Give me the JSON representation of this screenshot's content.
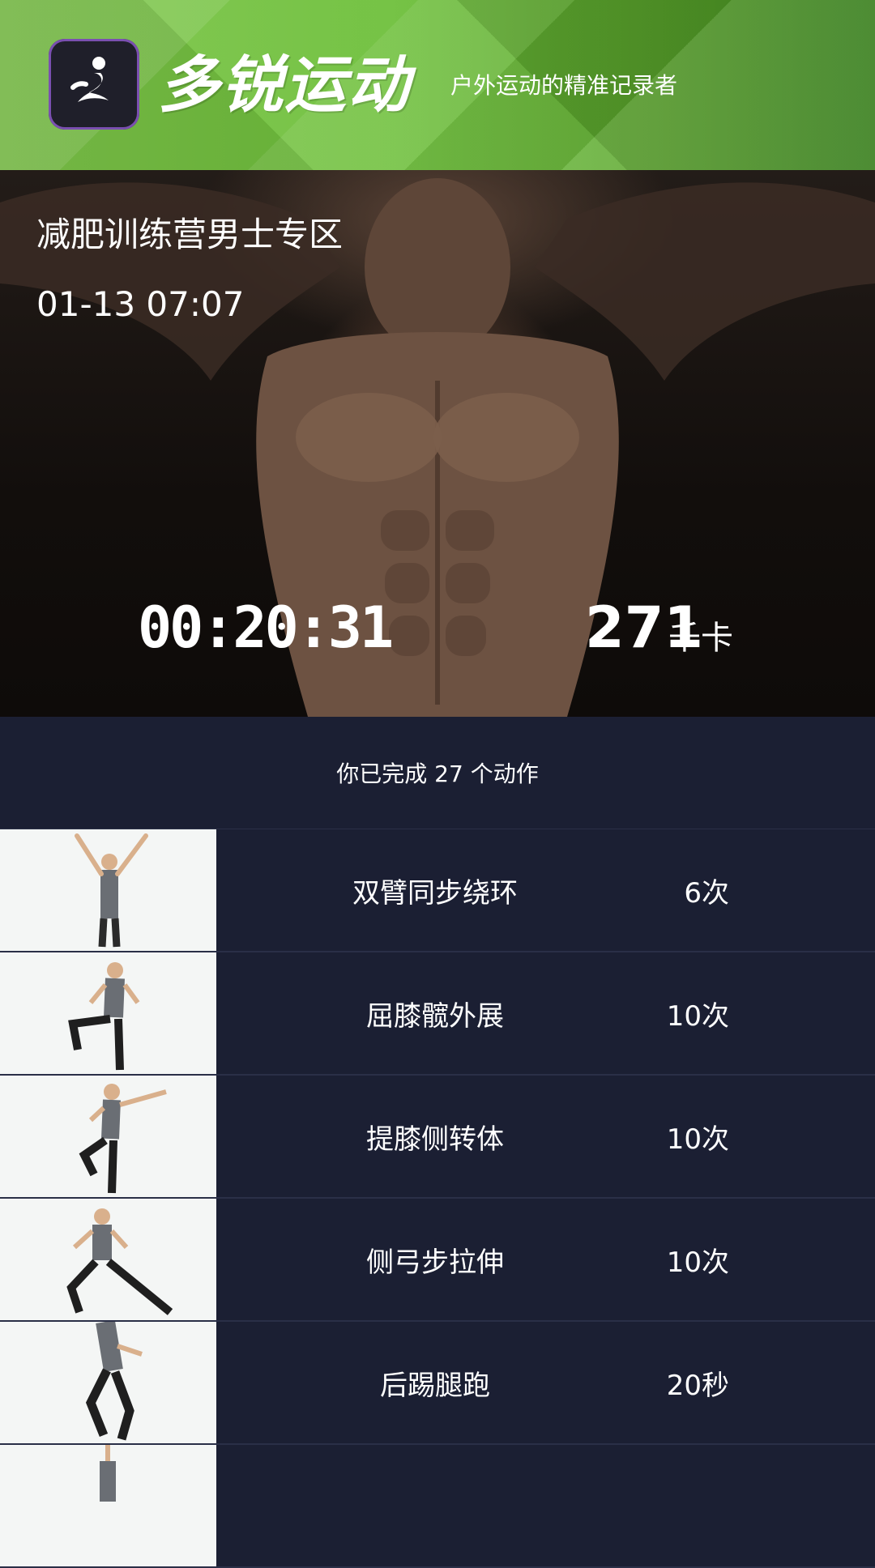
{
  "header": {
    "brand": "多锐运动",
    "tagline": "户外运动的精准记录者",
    "logo_icon": "runner-logo-icon"
  },
  "hero": {
    "title": "减肥训练营男士专区",
    "datetime": "01-13 07:07",
    "duration": "00:20:31",
    "calories": "271",
    "calories_unit": "千卡"
  },
  "summary": {
    "text": "你已完成 27 个动作"
  },
  "exercises": [
    {
      "name": "双臂同步绕环",
      "count": "6次"
    },
    {
      "name": "屈膝髋外展",
      "count": "10次"
    },
    {
      "name": "提膝侧转体",
      "count": "10次"
    },
    {
      "name": "侧弓步拉伸",
      "count": "10次"
    },
    {
      "name": "后踢腿跑",
      "count": "20秒"
    },
    {
      "name": "",
      "count": ""
    }
  ],
  "colors": {
    "header_green": "#6dbf3a",
    "list_bg": "#1b1f33",
    "divider": "#2a2f47"
  }
}
